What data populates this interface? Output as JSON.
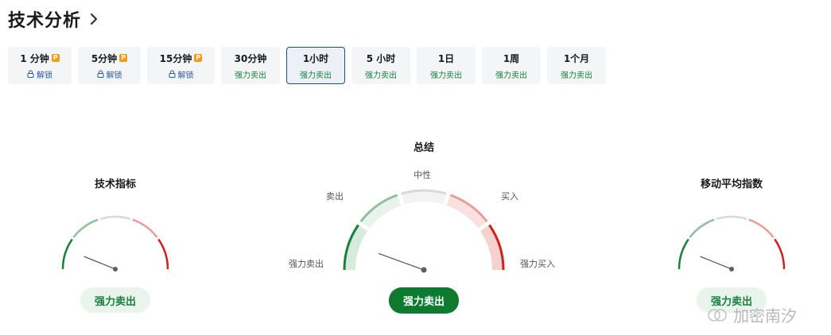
{
  "header": {
    "title": "技术分析",
    "chevron_icon": "chevron-right-icon"
  },
  "tabs": [
    {
      "label": "1 分钟",
      "sub": "解锁",
      "locked": true,
      "pro": true,
      "active": false
    },
    {
      "label": "5分钟",
      "sub": "解锁",
      "locked": true,
      "pro": true,
      "active": false
    },
    {
      "label": "15分钟",
      "sub": "解锁",
      "locked": true,
      "pro": true,
      "active": false
    },
    {
      "label": "30分钟",
      "sub": "强力卖出",
      "locked": false,
      "pro": false,
      "active": false
    },
    {
      "label": "1小时",
      "sub": "强力卖出",
      "locked": false,
      "pro": false,
      "active": true
    },
    {
      "label": "5 小时",
      "sub": "强力卖出",
      "locked": false,
      "pro": false,
      "active": false
    },
    {
      "label": "1日",
      "sub": "强力卖出",
      "locked": false,
      "pro": false,
      "active": false
    },
    {
      "label": "1周",
      "sub": "强力卖出",
      "locked": false,
      "pro": false,
      "active": false
    },
    {
      "label": "1个月",
      "sub": "强力卖出",
      "locked": false,
      "pro": false,
      "active": false
    }
  ],
  "gauges": {
    "left": {
      "title": "技术指标",
      "result": "强力卖出"
    },
    "summary": {
      "title": "总结",
      "result": "强力卖出",
      "labels": {
        "strong_sell": "强力卖出",
        "sell": "卖出",
        "neutral": "中性",
        "buy": "买入",
        "strong_buy": "强力买入"
      }
    },
    "right": {
      "title": "移动平均指数",
      "result": "强力卖出"
    }
  },
  "colors": {
    "strong_sell": "#18803c",
    "sell": "#8fbf9d",
    "neutral": "#d9d9d9",
    "buy": "#ec9c98",
    "strong_buy": "#d0211c",
    "needle": "#5b5f69",
    "active_tab_border": "#1f4d8c",
    "pill_dark": "#0e7a2f"
  },
  "watermark": {
    "text": "加密南汐",
    "icon": "watermark-logo-icon"
  }
}
